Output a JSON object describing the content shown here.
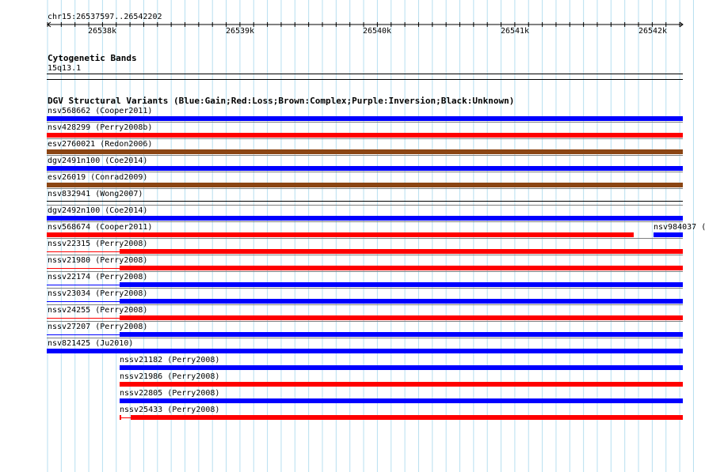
{
  "ruler": {
    "location": "chr15:26537597..26542202",
    "ticks": [
      "26538k",
      "26539k",
      "26540k",
      "26541k",
      "26542k"
    ]
  },
  "cytoband_track": {
    "title": "Cytogenetic Bands",
    "band": "15q13.1"
  },
  "dgv_track": {
    "title": "DGV Structural Variants (Blue:Gain;Red:Loss;Brown:Complex;Purple:Inversion;Black:Unknown)",
    "colors": {
      "gain": "#0000ff",
      "loss": "#ff0000",
      "complex": "#8b4513",
      "inversion": "#800080",
      "unknown": "#000000"
    },
    "variants": [
      {
        "label": "nsv568662 (Cooper2011)",
        "type": "gain"
      },
      {
        "label": "nsv428299 (Perry2008b)",
        "type": "loss"
      },
      {
        "label": "esv2760021 (Redon2006)",
        "type": "complex"
      },
      {
        "label": "dgv2491n100 (Coe2014)",
        "type": "gain"
      },
      {
        "label": "esv26019 (Conrad2009)",
        "type": "complex"
      },
      {
        "label": "nsv832941 (Wong2007)",
        "type": "unknown"
      },
      {
        "label": "dgv2492n100 (Coe2014)",
        "type": "gain"
      },
      {
        "label": "nsv568674 (Cooper2011)",
        "type": "loss",
        "extra_label": "nsv984037 (",
        "extra_type": "gain"
      },
      {
        "label": "nssv22315 (Perry2008)",
        "type": "loss"
      },
      {
        "label": "nssv21980 (Perry2008)",
        "type": "loss"
      },
      {
        "label": "nssv22174 (Perry2008)",
        "type": "gain"
      },
      {
        "label": "nssv23034 (Perry2008)",
        "type": "gain"
      },
      {
        "label": "nssv24255 (Perry2008)",
        "type": "loss"
      },
      {
        "label": "nssv27207 (Perry2008)",
        "type": "gain"
      },
      {
        "label": "nsv821425 (Ju2010)",
        "type": "gain"
      },
      {
        "label": "nssv21182 (Perry2008)",
        "type": "gain"
      },
      {
        "label": "nssv21986 (Perry2008)",
        "type": "loss"
      },
      {
        "label": "nssv22805 (Perry2008)",
        "type": "gain"
      },
      {
        "label": "nssv25433 (Perry2008)",
        "type": "loss"
      }
    ]
  }
}
